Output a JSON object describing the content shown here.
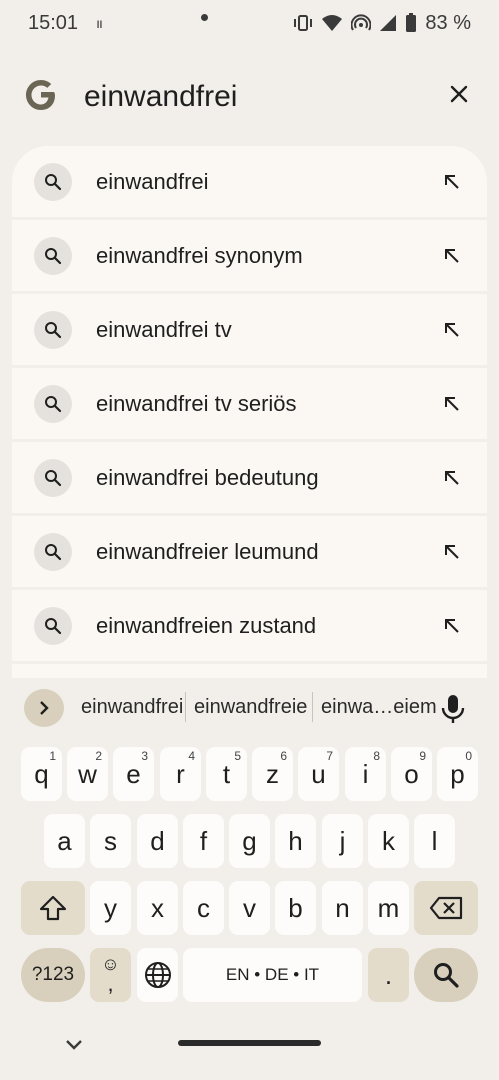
{
  "status_bar": {
    "time": "15:01",
    "left_indicator": "ıı",
    "battery": "83 %"
  },
  "search": {
    "query": "einwandfrei",
    "logo": "google-g-logo",
    "clear_icon": "close-icon"
  },
  "suggestions": [
    {
      "text": "einwandfrei"
    },
    {
      "text": "einwandfrei synonym"
    },
    {
      "text": "einwandfrei tv"
    },
    {
      "text": "einwandfrei tv seriös"
    },
    {
      "text": "einwandfrei bedeutung"
    },
    {
      "text": "einwandfreier leumund"
    },
    {
      "text": "einwandfreien zustand"
    }
  ],
  "keyboard": {
    "word_suggestions": [
      "einwandfrei",
      "einwandfreie",
      "einwa…eiem"
    ],
    "row1": [
      {
        "k": "q",
        "h": "1"
      },
      {
        "k": "w",
        "h": "2"
      },
      {
        "k": "e",
        "h": "3"
      },
      {
        "k": "r",
        "h": "4"
      },
      {
        "k": "t",
        "h": "5"
      },
      {
        "k": "z",
        "h": "6"
      },
      {
        "k": "u",
        "h": "7"
      },
      {
        "k": "i",
        "h": "8"
      },
      {
        "k": "o",
        "h": "9"
      },
      {
        "k": "p",
        "h": "0"
      }
    ],
    "row2": [
      "a",
      "s",
      "d",
      "f",
      "g",
      "h",
      "j",
      "k",
      "l"
    ],
    "row3": [
      "y",
      "x",
      "c",
      "v",
      "b",
      "n",
      "m"
    ],
    "symbols_key": "?123",
    "emoji_key_top": "☺",
    "emoji_key_bottom": ",",
    "space_label": "EN • DE • IT",
    "period_key": "."
  },
  "colors": {
    "background": "#f2efea",
    "suggestion_bg": "#fbf8f4",
    "accent_key": "#d8d0bd",
    "function_key": "#e4dccb"
  }
}
